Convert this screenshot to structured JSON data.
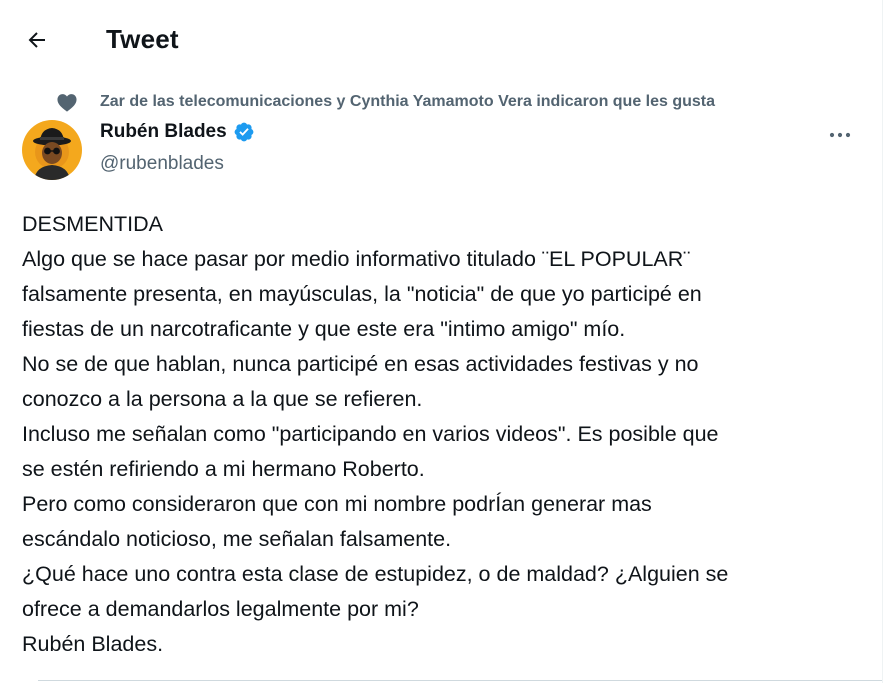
{
  "header": {
    "title": "Tweet"
  },
  "social_context": {
    "text": "Zar de las telecomunicaciones y Cynthia Yamamoto Vera indicaron que les gusta"
  },
  "author": {
    "name": "Rubén Blades",
    "handle": "@rubenblades",
    "verified": true
  },
  "tweet": {
    "lines": [
      "DESMENTIDA",
      "Algo que se hace pasar por medio informativo titulado ¨EL POPULAR¨",
      "falsamente presenta, en mayúsculas, la \"noticia\" de que yo participé en",
      "fiestas de un narcotraficante y que este era \"intimo amigo\" mío.",
      "No se de que hablan, nunca participé en esas actividades festivas y no",
      "conozco a la persona a la que se refieren.",
      "Incluso me señalan como \"participando en varios videos\". Es posible que",
      "se estén refiriendo a mi hermano Roberto.",
      "Pero como consideraron que con mi nombre podrÍan generar mas",
      "escándalo noticioso, me señalan falsamente.",
      "¿Qué hace uno contra esta clase de estupidez, o de maldad? ¿Alguien se",
      "ofrece a demandarlos  legalmente por mi?",
      "Rubén Blades."
    ]
  },
  "icons": {
    "back": "arrow-left-icon",
    "like_context": "heart-icon",
    "verified": "verified-badge-icon",
    "more": "more-horizontal-icon"
  },
  "colors": {
    "text_primary": "#0f1419",
    "text_secondary": "#536471",
    "verified_blue": "#1d9bf0",
    "avatar_bg": "#f4a81d"
  }
}
